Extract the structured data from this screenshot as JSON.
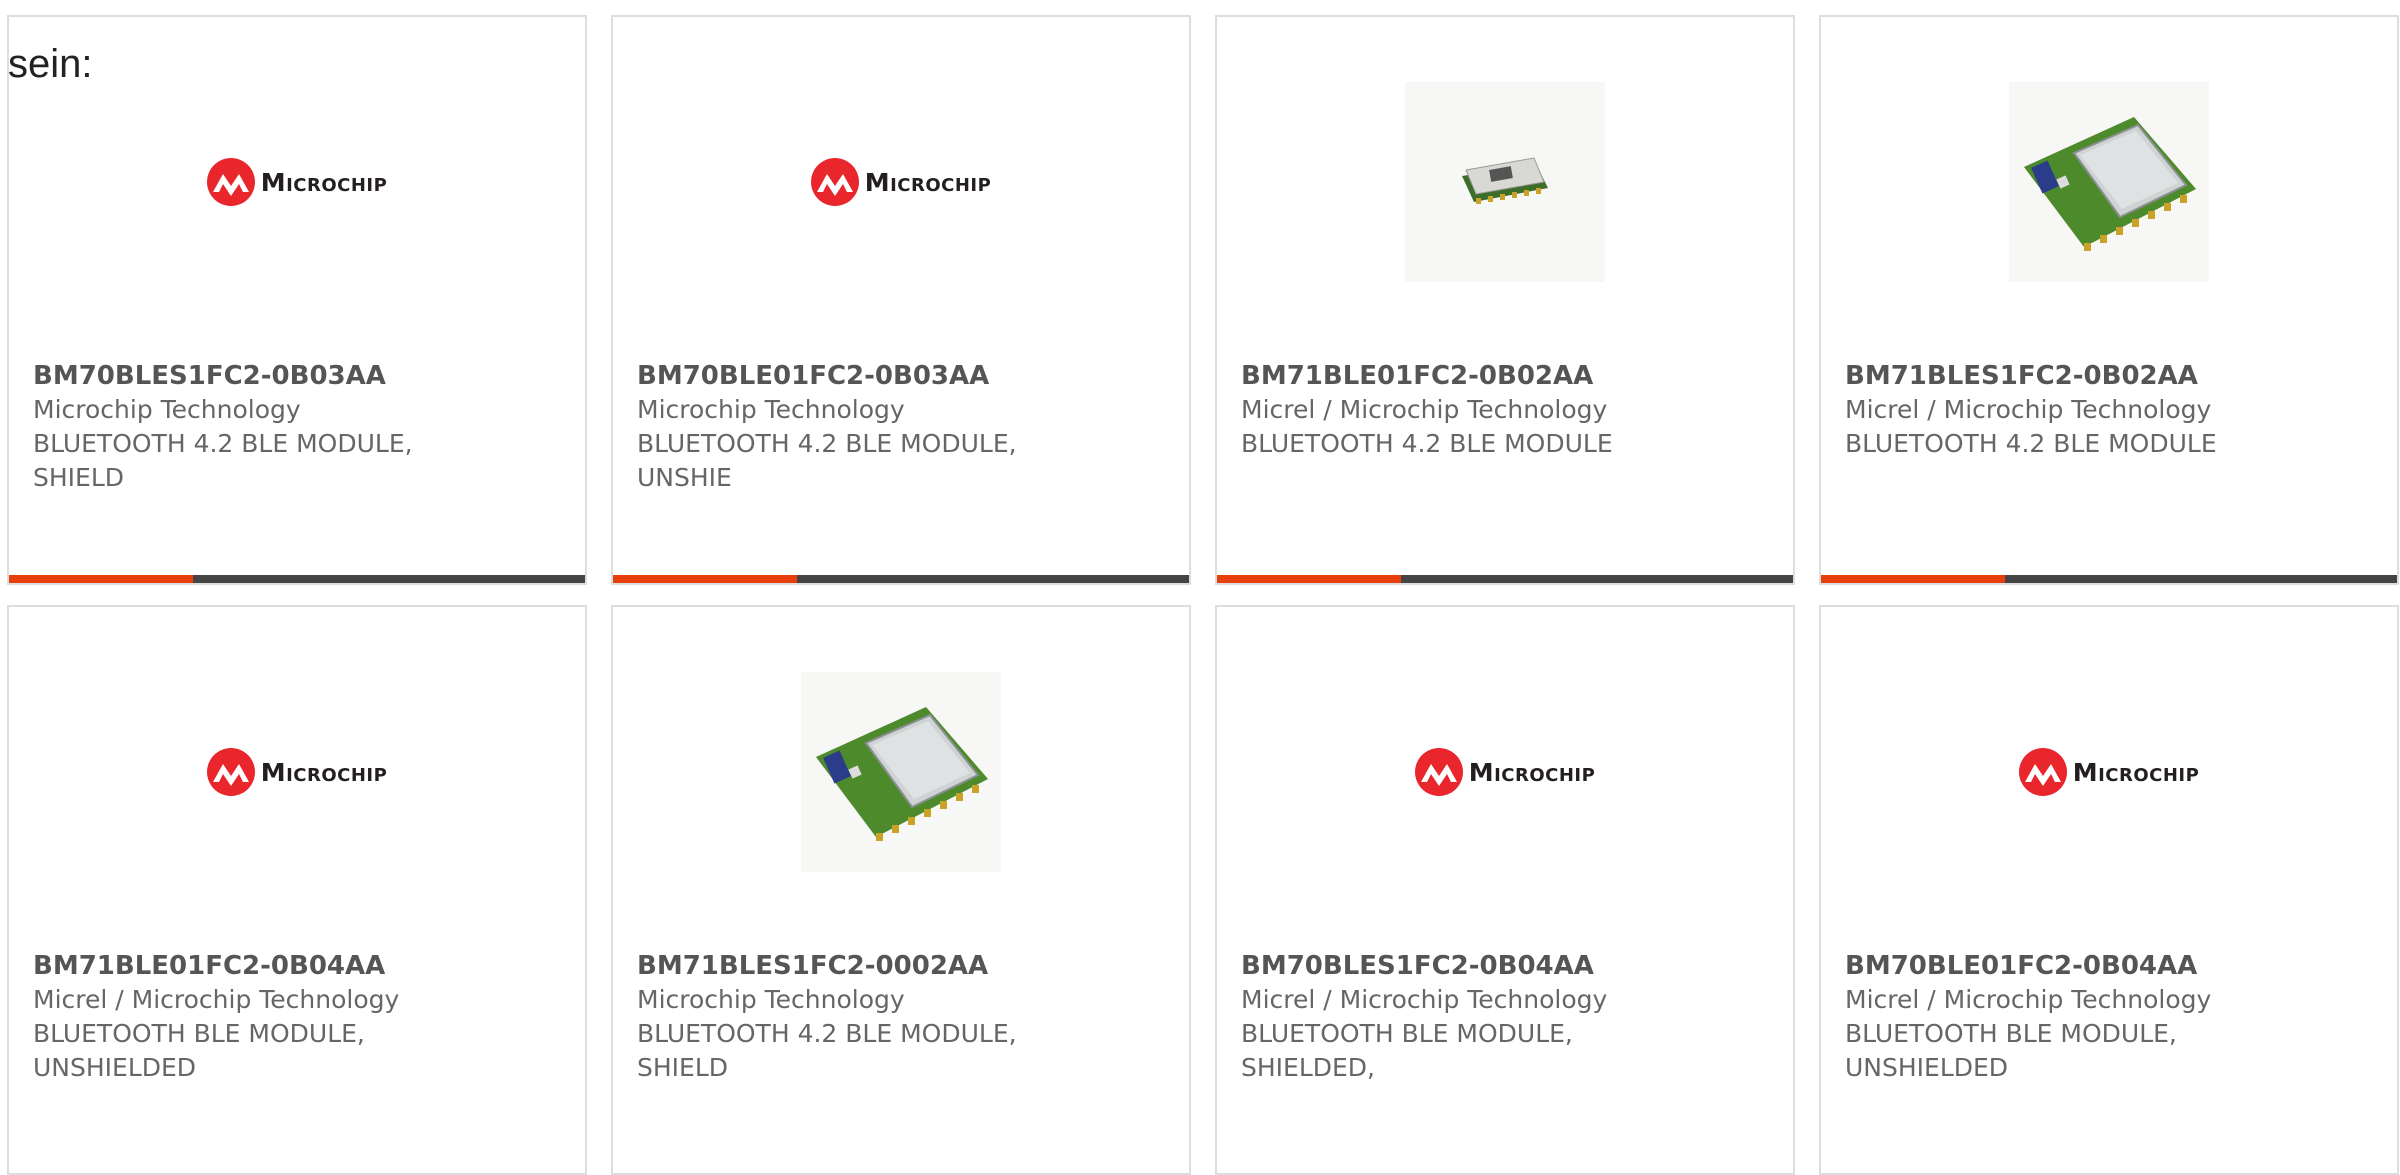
{
  "intro_text": "sein:",
  "brand_logo_text": "Microchip",
  "colors": {
    "accent_bar": "#e8400c",
    "bar_track": "#444444",
    "logo_red": "#e8262c"
  },
  "products": [
    {
      "part_number": "BM70BLES1FC2-0B03AA",
      "manufacturer": "Microchip Technology",
      "description": "BLUETOOTH 4.2 BLE MODULE, SHIELD",
      "image": "microchip-logo",
      "show_bar": true
    },
    {
      "part_number": "BM70BLE01FC2-0B03AA",
      "manufacturer": "Microchip Technology",
      "description": "BLUETOOTH 4.2 BLE MODULE, UNSHIE",
      "image": "microchip-logo",
      "show_bar": true
    },
    {
      "part_number": "BM71BLE01FC2-0B02AA",
      "manufacturer": "Micrel / Microchip Technology",
      "description": "BLUETOOTH 4.2 BLE MODULE",
      "image": "small-module-photo",
      "show_bar": true
    },
    {
      "part_number": "BM71BLES1FC2-0B02AA",
      "manufacturer": "Micrel / Microchip Technology",
      "description": "BLUETOOTH 4.2 BLE MODULE",
      "image": "shielded-module-photo",
      "show_bar": true
    },
    {
      "part_number": "BM71BLE01FC2-0B04AA",
      "manufacturer": "Micrel / Microchip Technology",
      "description": "BLUETOOTH BLE MODULE, UNSHIELDED",
      "image": "microchip-logo",
      "show_bar": false
    },
    {
      "part_number": "BM71BLES1FC2-0002AA",
      "manufacturer": "Microchip Technology",
      "description": "BLUETOOTH 4.2 BLE MODULE, SHIELD",
      "image": "shielded-module-photo",
      "show_bar": false
    },
    {
      "part_number": "BM70BLES1FC2-0B04AA",
      "manufacturer": "Micrel / Microchip Technology",
      "description": "BLUETOOTH BLE MODULE, SHIELDED,",
      "image": "microchip-logo",
      "show_bar": false
    },
    {
      "part_number": "BM70BLE01FC2-0B04AA",
      "manufacturer": "Micrel / Microchip Technology",
      "description": "BLUETOOTH BLE MODULE, UNSHIELDED",
      "image": "microchip-logo",
      "show_bar": false
    }
  ]
}
